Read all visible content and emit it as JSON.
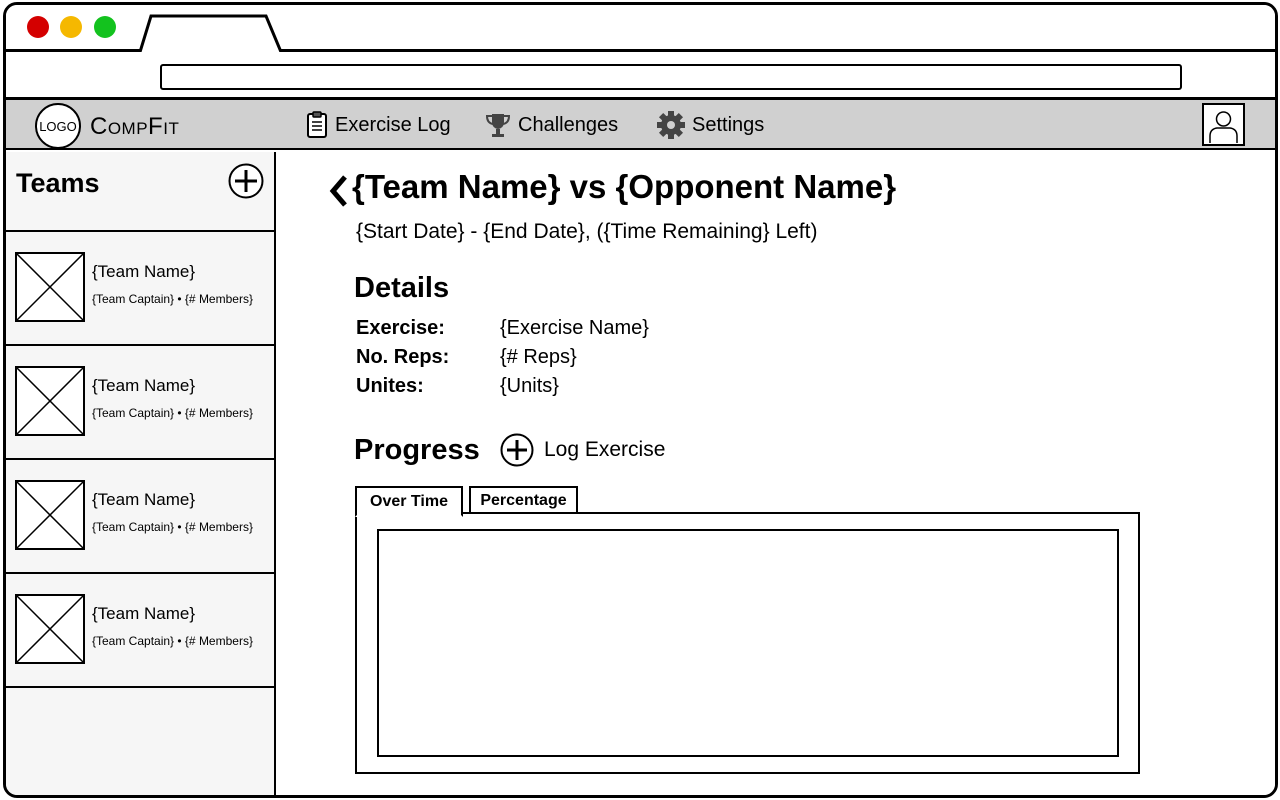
{
  "app": {
    "logo_text": "LOGO",
    "name": "CompFit"
  },
  "nav": {
    "items": [
      {
        "label": "Exercise Log",
        "icon": "clipboard-icon"
      },
      {
        "label": "Challenges",
        "icon": "trophy-icon"
      },
      {
        "label": "Settings",
        "icon": "gear-icon"
      }
    ]
  },
  "sidebar": {
    "title": "Teams",
    "teams": [
      {
        "name": "{Team Name}",
        "meta": "{Team Captain} • {# Members}"
      },
      {
        "name": "{Team Name}",
        "meta": "{Team Captain} • {# Members}"
      },
      {
        "name": "{Team Name}",
        "meta": "{Team Captain} • {# Members}"
      },
      {
        "name": "{Team Name}",
        "meta": "{Team Captain} • {# Members}"
      }
    ]
  },
  "main": {
    "title": "{Team Name} vs {Opponent Name}",
    "date_line": "{Start Date} - {End Date}, ({Time Remaining} Left)",
    "details_title": "Details",
    "details": [
      {
        "label": "Exercise:",
        "value": "{Exercise Name}"
      },
      {
        "label": "No. Reps:",
        "value": "{# Reps}"
      },
      {
        "label": "Unites:",
        "value": "{Units}"
      }
    ],
    "progress_title": "Progress",
    "log_exercise_label": "Log Exercise",
    "tabs": [
      {
        "label": "Over Time",
        "active": true
      },
      {
        "label": "Percentage",
        "active": false
      }
    ]
  },
  "colors": {
    "close": "#d40000",
    "minimize": "#f5b800",
    "maximize": "#13c21e",
    "navbar": "#d0d0d0",
    "sidebar": "#f6f6f6"
  }
}
